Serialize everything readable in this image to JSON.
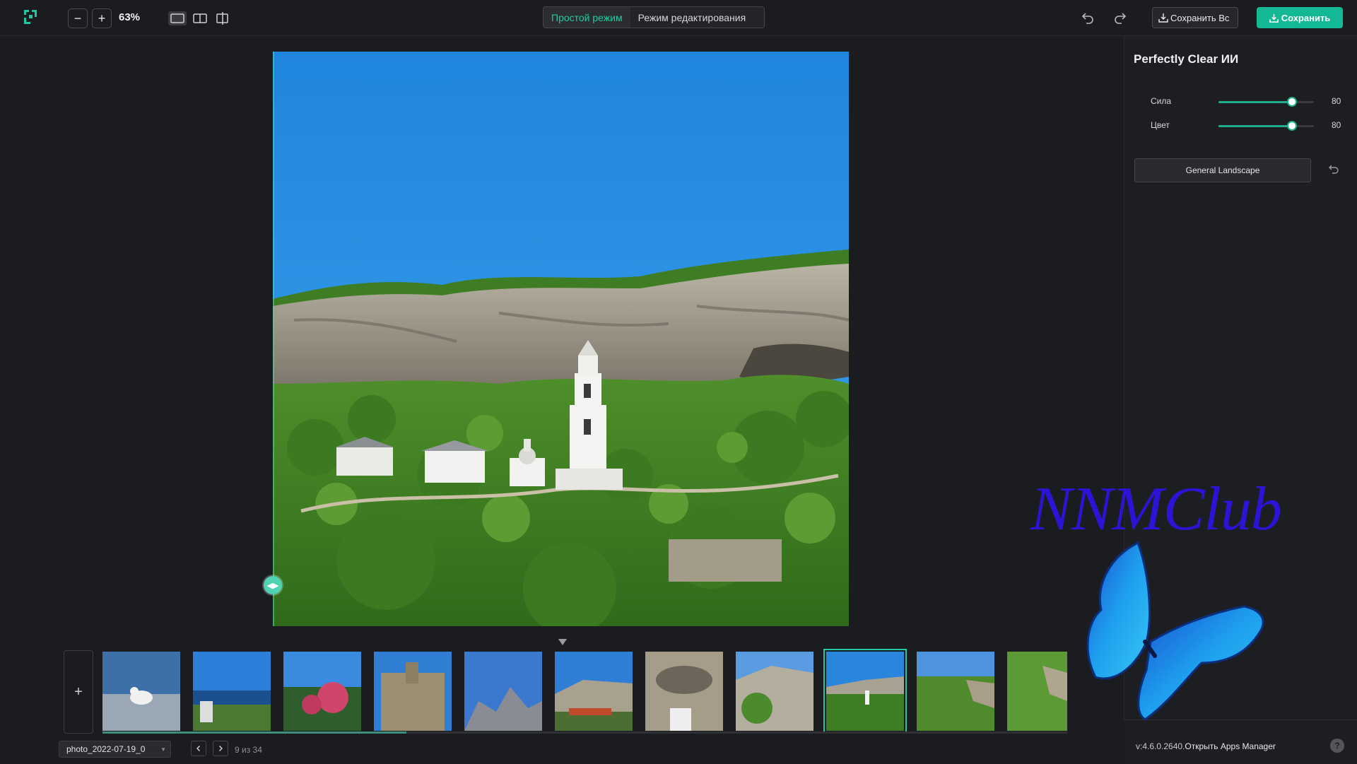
{
  "toolbar": {
    "zoom_level": "63%",
    "zoom_out_symbol": "−",
    "zoom_in_symbol": "+",
    "view_modes": [
      "single-view-icon",
      "split-view-icon",
      "crop-view-icon"
    ],
    "mode_tabs": [
      {
        "label": "Простой режим",
        "active": true
      },
      {
        "label": "Режим редактирования",
        "active": false
      }
    ],
    "export_label": "Сохранить Вс",
    "save_label": "Сохранить"
  },
  "panel": {
    "title": "Perfectly Clear ИИ",
    "sliders": [
      {
        "label": "Сила",
        "value": "80",
        "fraction": 0.77
      },
      {
        "label": "Цвет",
        "value": "80",
        "fraction": 0.77
      }
    ],
    "preset": "General Landscape",
    "version": "v:4.6.0.2640.",
    "apps_manager_link": "Открыть Apps Manager",
    "help_symbol": "?"
  },
  "filmstrip": {
    "add_symbol": "+",
    "file_name": "photo_2022-07-19_0",
    "counter": "9 из 34",
    "selected_index": 8,
    "thumbnails": [
      "seagull-thumb",
      "terrace-thumb",
      "flowers-thumb",
      "palace-thumb",
      "mountains-thumb",
      "cliff-cafe-thumb",
      "cave-thumb",
      "rock-thumb",
      "monastery-thumb",
      "valley-thumb",
      "forest-thumb"
    ]
  },
  "watermark": {
    "text": "NNMClub"
  },
  "colors": {
    "accent": "#23c9a5",
    "save_button": "#13b894",
    "background": "#1b1c1f",
    "watermark": "#2b14d6"
  }
}
